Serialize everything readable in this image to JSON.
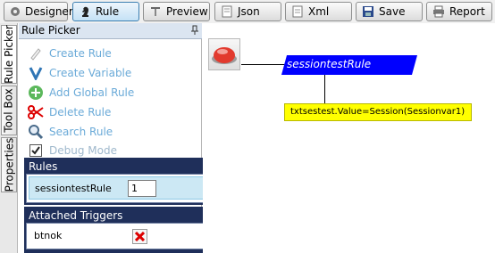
{
  "toolbar": {
    "buttons": [
      {
        "label": "Designer",
        "icon": "gear-icon"
      },
      {
        "label": "Rule",
        "icon": "chess-knight-icon",
        "active": true
      },
      {
        "label": "Preview",
        "icon": "preview-icon"
      },
      {
        "label": "Json",
        "icon": "json-icon"
      },
      {
        "label": "Xml",
        "icon": "xml-icon"
      },
      {
        "label": "Save",
        "icon": "floppy-disk-icon"
      },
      {
        "label": "Report",
        "icon": "printer-icon"
      }
    ]
  },
  "side_tabs": [
    "Rule Picker",
    "Tool Box",
    "Properties"
  ],
  "rule_picker": {
    "title": "Rule Picker",
    "items": [
      {
        "label": "Create Rule",
        "icon": "create-rule-icon"
      },
      {
        "label": "Create Variable",
        "icon": "variable-v-icon"
      },
      {
        "label": "Add Global Rule",
        "icon": "add-global-icon"
      },
      {
        "label": "Delete Rule",
        "icon": "scissors-icon"
      },
      {
        "label": "Search Rule",
        "icon": "magnifier-icon"
      },
      {
        "label": "Debug Mode",
        "icon": "checkbox-checked-icon",
        "checked": true
      }
    ]
  },
  "rules_group": {
    "title": "Rules",
    "rows": [
      {
        "name": "sessiontestRule",
        "count": "1"
      }
    ]
  },
  "triggers_group": {
    "title": "Attached Triggers",
    "rows": [
      {
        "name": "btnok"
      }
    ]
  },
  "canvas": {
    "rule_node_label": "sessiontestRule",
    "action_label": "txtsestest.Value=Session(Sessionvar1)"
  },
  "colors": {
    "rule_node": "#0000ff",
    "action_node": "#ffff00",
    "group_header": "#1f2f5a",
    "picker_text": "#6aaad8",
    "selected_row": "#cce8f4"
  }
}
